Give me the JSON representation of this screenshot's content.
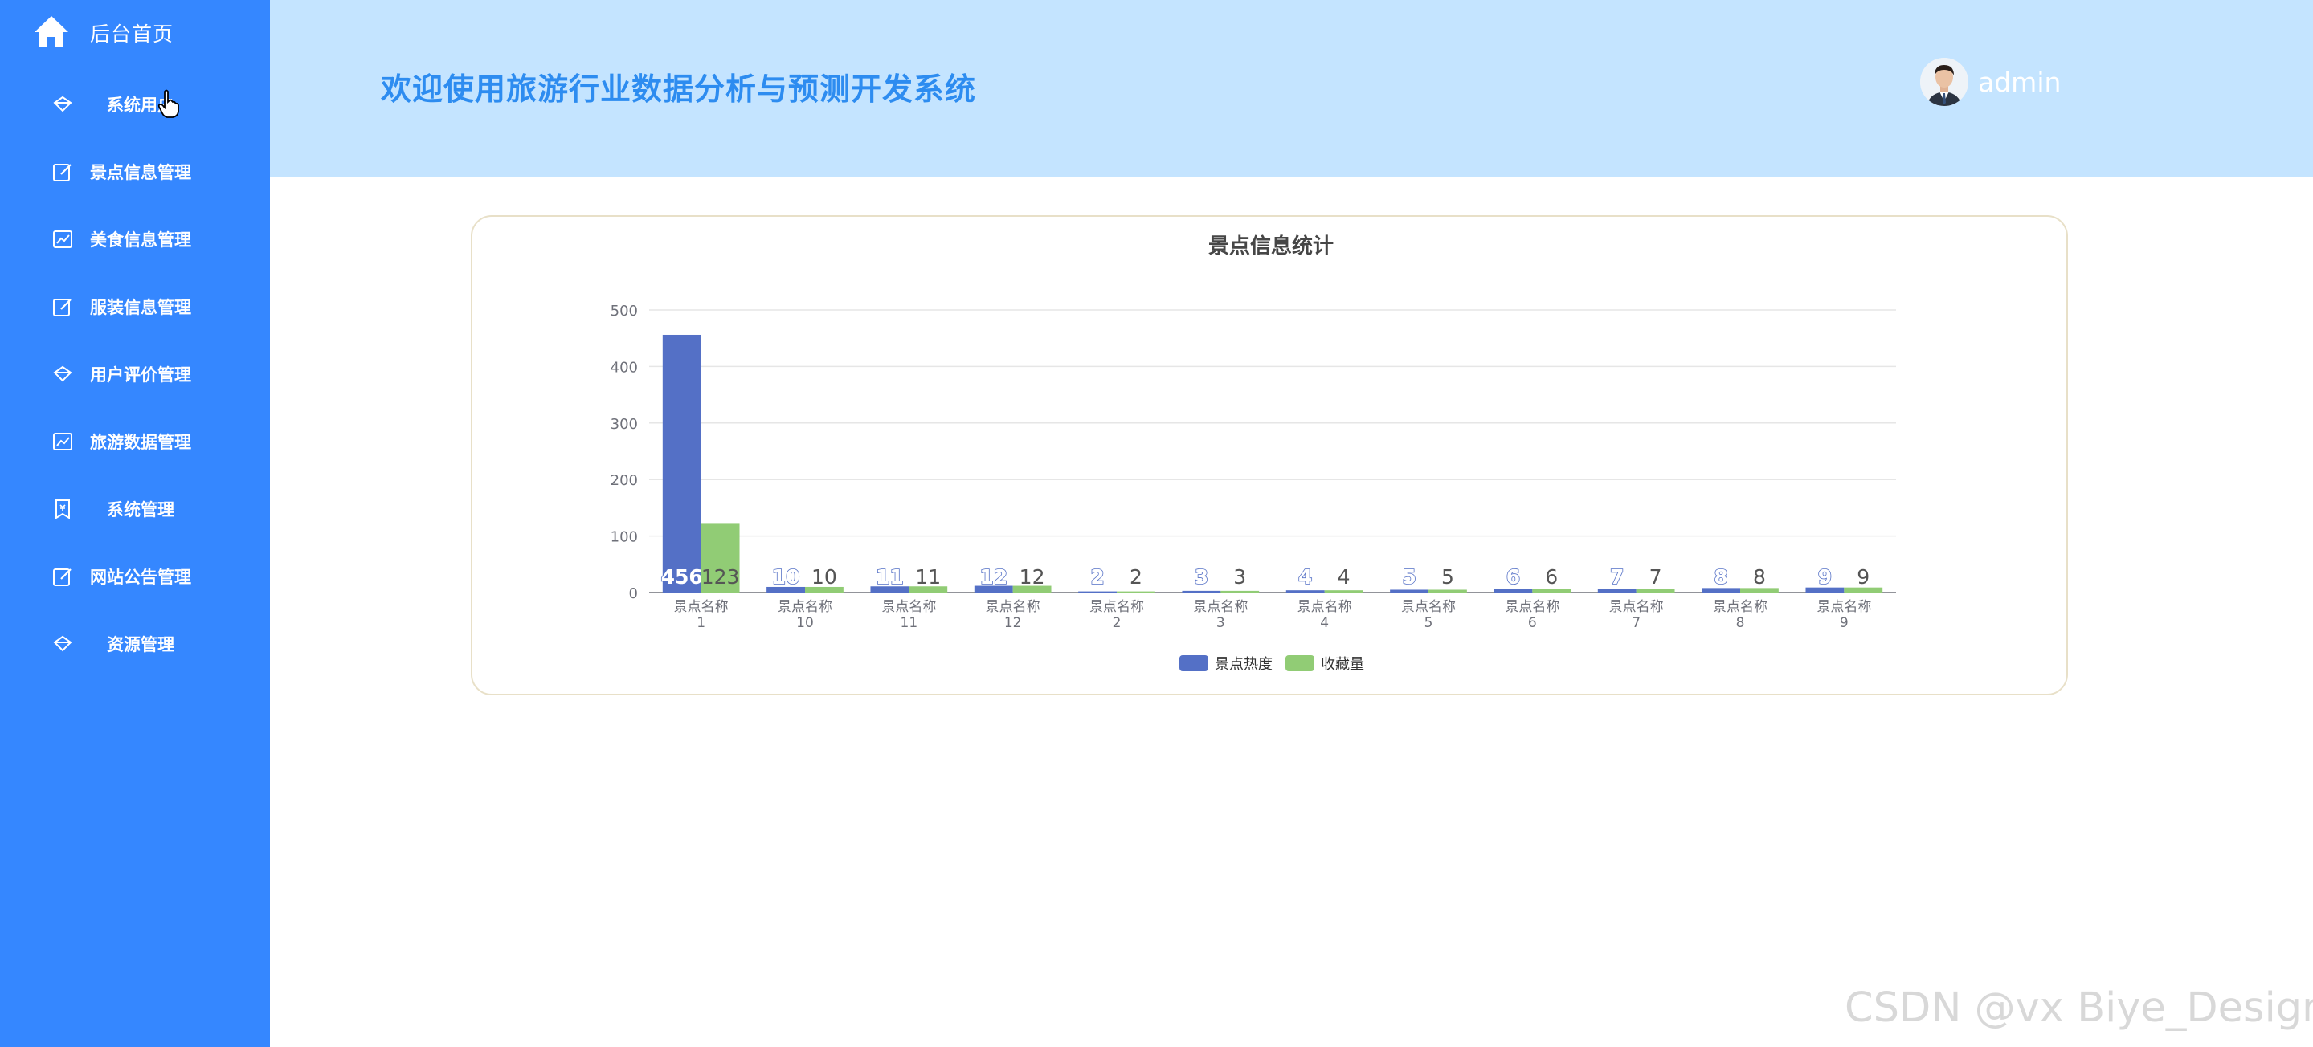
{
  "sidebar": {
    "home_label": "后台首页",
    "items": [
      {
        "label": "系统用户",
        "icon": "diamond-icon"
      },
      {
        "label": "景点信息管理",
        "icon": "edit-icon"
      },
      {
        "label": "美食信息管理",
        "icon": "chart-line-icon"
      },
      {
        "label": "服装信息管理",
        "icon": "edit-icon"
      },
      {
        "label": "用户评价管理",
        "icon": "diamond-icon"
      },
      {
        "label": "旅游数据管理",
        "icon": "chart-line-icon"
      },
      {
        "label": "系统管理",
        "icon": "ticket-icon"
      },
      {
        "label": "网站公告管理",
        "icon": "edit-icon"
      },
      {
        "label": "资源管理",
        "icon": "diamond-icon"
      }
    ]
  },
  "header": {
    "welcome": "欢迎使用旅游行业数据分析与预测开发系统",
    "username": "admin"
  },
  "colors": {
    "sidebar_bg": "#3587ff",
    "header_bg": "#c4e4ff",
    "title_blue": "#2d8cf0",
    "series_heat": "#5470c6",
    "series_fav": "#91cc75"
  },
  "chart_data": {
    "type": "bar",
    "title": "景点信息统计",
    "categories": [
      "景点名称1",
      "景点名称10",
      "景点名称11",
      "景点名称12",
      "景点名称2",
      "景点名称3",
      "景点名称4",
      "景点名称5",
      "景点名称6",
      "景点名称7",
      "景点名称8",
      "景点名称9"
    ],
    "category_lines": [
      [
        "景点名称",
        "1"
      ],
      [
        "景点名称",
        "10"
      ],
      [
        "景点名称",
        "11"
      ],
      [
        "景点名称",
        "12"
      ],
      [
        "景点名称",
        "2"
      ],
      [
        "景点名称",
        "3"
      ],
      [
        "景点名称",
        "4"
      ],
      [
        "景点名称",
        "5"
      ],
      [
        "景点名称",
        "6"
      ],
      [
        "景点名称",
        "7"
      ],
      [
        "景点名称",
        "8"
      ],
      [
        "景点名称",
        "9"
      ]
    ],
    "series": [
      {
        "name": "景点热度",
        "color": "#5470c6",
        "values": [
          456,
          10,
          11,
          12,
          2,
          3,
          4,
          5,
          6,
          7,
          8,
          9
        ]
      },
      {
        "name": "收藏量",
        "color": "#91cc75",
        "values": [
          123,
          10,
          11,
          12,
          2,
          3,
          4,
          5,
          6,
          7,
          8,
          9
        ]
      }
    ],
    "ylim": [
      0,
      500
    ],
    "yticks": [
      0,
      100,
      200,
      300,
      400,
      500
    ],
    "grid": true,
    "legend": "bottom-center"
  },
  "watermark": "CSDN @vx Biye_Design"
}
